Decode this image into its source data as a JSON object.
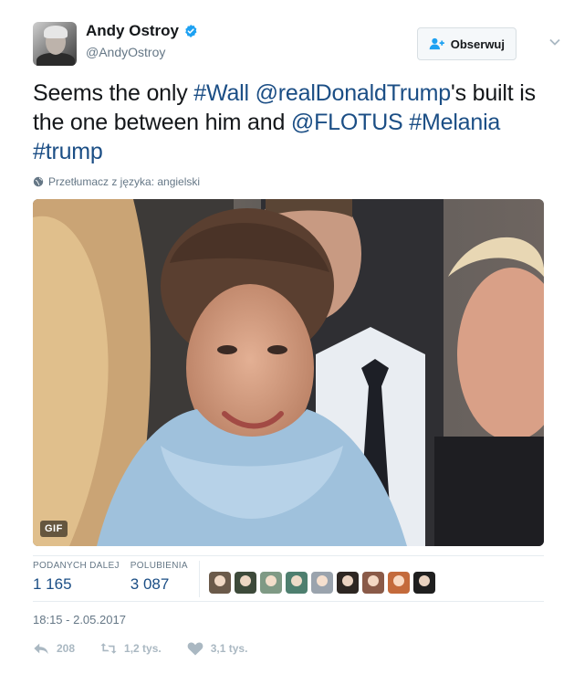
{
  "author": {
    "display_name": "Andy Ostroy",
    "handle": "@AndyOstroy",
    "verified": true
  },
  "follow_button": {
    "label": "Obserwuj",
    "icon": "add-user-icon"
  },
  "tweet": {
    "segments": [
      {
        "text": "Seems the only ",
        "link": false
      },
      {
        "text": "#Wall",
        "link": true
      },
      {
        "text": " ",
        "link": false
      },
      {
        "text": "@realDonaldTrump",
        "link": true
      },
      {
        "text": "'s built is the one between him and ",
        "link": false
      },
      {
        "text": "@FLOTUS",
        "link": true
      },
      {
        "text": " ",
        "link": false
      },
      {
        "text": "#Melania",
        "link": true
      },
      {
        "text": " ",
        "link": false
      },
      {
        "text": "#trump",
        "link": true
      }
    ],
    "translate_label": "Przetłumacz z języka: angielski",
    "media_badge": "GIF"
  },
  "stats": {
    "retweets_label": "PODANYCH DALEJ",
    "retweets_value": "1 165",
    "likes_label": "POLUBIENIA",
    "likes_value": "3 087",
    "liker_colors": [
      "#6b5a4a",
      "#3d4a3a",
      "#7f9a85",
      "#4e7f6f",
      "#9aa3ad",
      "#2d2622",
      "#8a5a48",
      "#c46a3b",
      "#1f1f1f"
    ]
  },
  "timestamp": "18:15 - 2.05.2017",
  "actions": {
    "reply_count": "208",
    "retweet_count": "1,2 tys.",
    "like_count": "3,1 tys."
  },
  "colors": {
    "link": "#1b4e85",
    "secondary_text": "#657786",
    "verified_blue": "#1da1f2",
    "action_gray": "#aab8c2"
  }
}
